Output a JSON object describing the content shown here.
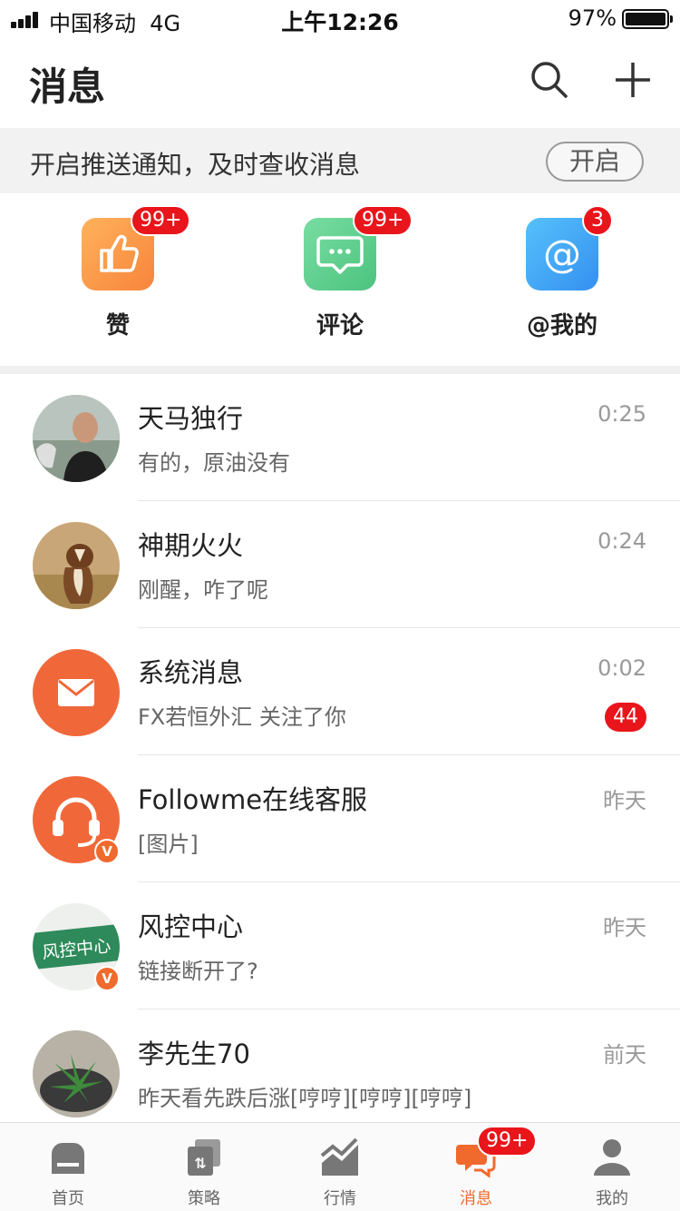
{
  "status_bar": {
    "carrier": "中国移动",
    "network": "4G",
    "time": "上午12:26",
    "battery": "97%"
  },
  "header": {
    "title": "消息",
    "search_icon": "search-icon",
    "add_icon": "plus-icon"
  },
  "push_banner": {
    "text": "开启推送通知，及时查收消息",
    "button_label": "开启"
  },
  "categories": [
    {
      "label": "赞",
      "badge": "99+",
      "icon": "thumbs-up-icon",
      "color": "#fb9a4b"
    },
    {
      "label": "评论",
      "badge": "99+",
      "icon": "comment-icon",
      "color": "#5fcf8f"
    },
    {
      "label": "@我的",
      "badge": "3",
      "icon": "at-icon",
      "color": "#3ea6f5"
    }
  ],
  "chats": [
    {
      "name": "天马独行",
      "preview": "有的，原油没有",
      "time": "0:25",
      "badge": ""
    },
    {
      "name": "神期火火",
      "preview": "刚醒，咋了呢",
      "time": "0:24",
      "badge": ""
    },
    {
      "name": "系统消息",
      "preview": "FX若恒外汇 关注了你",
      "time": "0:02",
      "badge": "44"
    },
    {
      "name": "Followme在线客服",
      "preview": "[图片]",
      "time": "昨天",
      "badge": "",
      "verified": "V"
    },
    {
      "name": "风控中心",
      "preview": "链接断开了?",
      "time": "昨天",
      "badge": "",
      "verified": "V",
      "avatar_text": "风控中心"
    },
    {
      "name": "李先生70",
      "preview": "昨天看先跌后涨[哼哼][哼哼][哼哼]",
      "time": "前天",
      "badge": ""
    }
  ],
  "tabs": [
    {
      "label": "首页",
      "icon": "home-icon"
    },
    {
      "label": "策略",
      "icon": "strategy-icon"
    },
    {
      "label": "行情",
      "icon": "market-chart-icon"
    },
    {
      "label": "消息",
      "icon": "messages-icon",
      "badge": "99+",
      "active": true
    },
    {
      "label": "我的",
      "icon": "profile-icon"
    }
  ],
  "colors": {
    "accent": "#f06a2e",
    "badge_red": "#e8151b",
    "banner_bg": "#f2f2f2"
  }
}
